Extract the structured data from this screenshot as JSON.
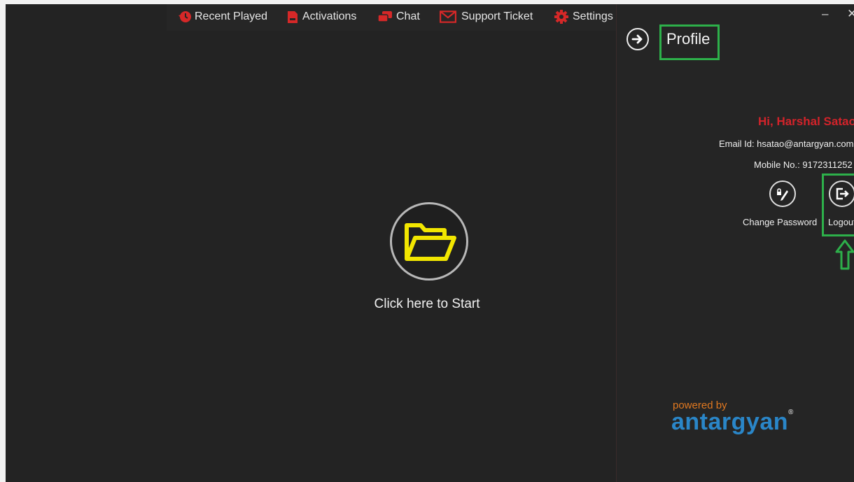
{
  "topbar": {
    "items": [
      {
        "label": "Recent Played",
        "icon": "history-icon"
      },
      {
        "label": "Activations",
        "icon": "document-icon"
      },
      {
        "label": "Chat",
        "icon": "chat-icon"
      },
      {
        "label": "Support Ticket",
        "icon": "envelope-icon"
      },
      {
        "label": "Settings",
        "icon": "gear-icon"
      }
    ],
    "icon_color": "#d62828"
  },
  "main": {
    "start_label": "Click here to Start",
    "folder_color": "#f2e600"
  },
  "window": {
    "minimize": "–",
    "close": "✕"
  },
  "profile": {
    "title": "Profile",
    "greeting": "Hi, Harshal Satao",
    "email": "Email Id: hsatao@antargyan.com",
    "mobile": "Mobile No.: 9172311252",
    "change_password": "Change Password",
    "logout": "Logout",
    "highlight_color": "#2db04a"
  },
  "branding": {
    "powered": "powered by",
    "brand": "antargyan",
    "reg": "®"
  }
}
